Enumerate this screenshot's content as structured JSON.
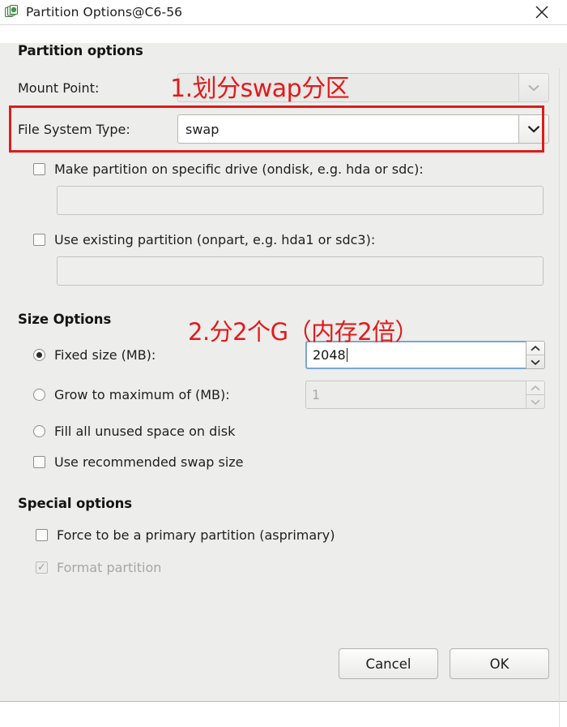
{
  "window": {
    "title": "Partition Options@C6-56",
    "icon": "partition-disk-icon",
    "close_label": "✕"
  },
  "sections": {
    "partition_options": {
      "heading": "Partition options",
      "mount_point": {
        "label": "Mount Point:",
        "value": "",
        "disabled": true,
        "chevron": "chevron-down-icon"
      },
      "file_system_type": {
        "label": "File System Type:",
        "value": "swap",
        "disabled": false,
        "chevron": "chevron-down-icon"
      },
      "ondisk": {
        "checkbox_label": "Make partition on specific drive (ondisk, e.g. hda or sdc):",
        "checked": false,
        "entry_value": ""
      },
      "onpart": {
        "checkbox_label": "Use existing partition (onpart, e.g. hda1 or sdc3):",
        "checked": false,
        "entry_value": ""
      }
    },
    "size_options": {
      "heading": "Size Options",
      "fixed_size": {
        "label": "Fixed size (MB):",
        "selected": true,
        "value": "2048",
        "focused": true
      },
      "grow_to_max": {
        "label": "Grow to maximum of (MB):",
        "selected": false,
        "value": "1",
        "disabled": true
      },
      "fill_all": {
        "label": "Fill all unused space on disk",
        "selected": false
      },
      "recommended_swap": {
        "label": "Use recommended swap size",
        "checked": false
      }
    },
    "special_options": {
      "heading": "Special options",
      "asprimary": {
        "label": "Force to be a primary partition (asprimary)",
        "checked": false
      },
      "format_partition": {
        "label": "Format partition",
        "checked": true,
        "disabled": true,
        "tick": "✓"
      }
    }
  },
  "buttons": {
    "cancel": "Cancel",
    "ok": "OK"
  },
  "annotations": [
    {
      "id": "anno1",
      "text": "1.划分swap分区",
      "color": "#e01b1b"
    },
    {
      "id": "anno2",
      "text": "2.分2个G（内存2倍）",
      "color": "#e01b1b"
    }
  ],
  "colors": {
    "dialog_background": "#ededeb",
    "titlebar_background": "#ffffff",
    "annotation_red": "#dc1c1c",
    "focus_blue": "#7aa7d4",
    "text": "#1e1e1e",
    "disabled_text": "#a6a6a2"
  }
}
